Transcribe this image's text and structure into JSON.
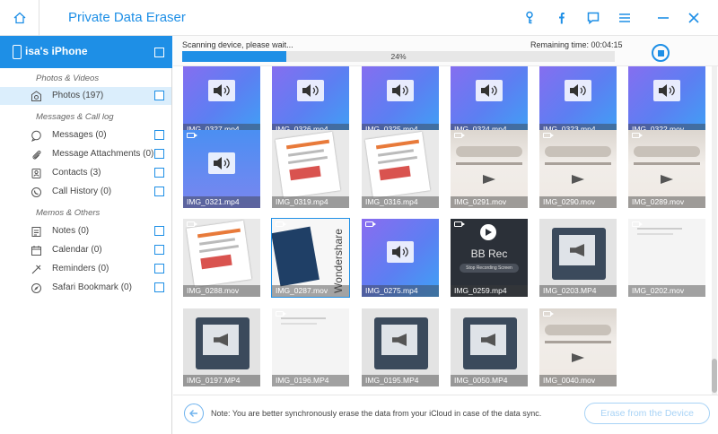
{
  "app": {
    "title": "Private Data Eraser"
  },
  "colors": {
    "accent": "#1e8fe6",
    "selected_row": "#dbeefc",
    "disabled_button": "#a8d3f6"
  },
  "titlebar_icons": [
    "key-icon",
    "facebook-icon",
    "feedback-icon",
    "menu-icon",
    "minimize-icon",
    "close-icon"
  ],
  "device": {
    "name": "isa's iPhone"
  },
  "sidebar": {
    "sections": [
      {
        "title": "Photos & Videos",
        "items": [
          {
            "label": "Photos (197)",
            "icon": "photos-icon",
            "selected": true
          }
        ]
      },
      {
        "title": "Messages & Call log",
        "items": [
          {
            "label": "Messages (0)",
            "icon": "messages-icon"
          },
          {
            "label": "Message Attachments (0)",
            "icon": "attachment-icon"
          },
          {
            "label": "Contacts (3)",
            "icon": "contacts-icon"
          },
          {
            "label": "Call History (0)",
            "icon": "call-history-icon"
          }
        ]
      },
      {
        "title": "Memos & Others",
        "items": [
          {
            "label": "Notes (0)",
            "icon": "notes-icon"
          },
          {
            "label": "Calendar (0)",
            "icon": "calendar-icon"
          },
          {
            "label": "Reminders (0)",
            "icon": "reminders-icon"
          },
          {
            "label": "Safari Bookmark (0)",
            "icon": "bookmark-icon"
          }
        ]
      }
    ]
  },
  "scan": {
    "status": "Scanning device, please wait...",
    "remaining": "Remaining time: 00:04:15",
    "percent_label": "24%",
    "progress": 0.24
  },
  "grid": {
    "rows": [
      [
        {
          "name": "IMG_0327.mp4",
          "kind": "purple"
        },
        {
          "name": "IMG_0326.mp4",
          "kind": "purple"
        },
        {
          "name": "IMG_0325.mp4",
          "kind": "purple"
        },
        {
          "name": "IMG_0324.mp4",
          "kind": "purple"
        },
        {
          "name": "IMG_0323.mp4",
          "kind": "purple"
        },
        {
          "name": "IMG_0322.mov",
          "kind": "purple",
          "video": true
        }
      ],
      [
        {
          "name": "IMG_0321.mp4",
          "kind": "blue",
          "video": true
        },
        {
          "name": "IMG_0319.mp4",
          "kind": "doc"
        },
        {
          "name": "IMG_0316.mp4",
          "kind": "doc"
        },
        {
          "name": "IMG_0291.mov",
          "kind": "panel",
          "video": true
        },
        {
          "name": "IMG_0290.mov",
          "kind": "panel",
          "video": true
        },
        {
          "name": "IMG_0289.mov",
          "kind": "panel",
          "video": true
        }
      ],
      [
        {
          "name": "IMG_0288.mov",
          "kind": "doc",
          "video": true
        },
        {
          "name": "IMG_0287.mov",
          "kind": "wondershare",
          "video": true,
          "selected": true,
          "overlay": "Wondershare"
        },
        {
          "name": "IMG_0275.mp4",
          "kind": "purple",
          "video": true
        },
        {
          "name": "IMG_0259.mp4",
          "kind": "bbrec",
          "video": true,
          "overlay": "BB Rec",
          "subtext": "Stop Recording Screen"
        },
        {
          "name": "IMG_0203.MP4",
          "kind": "phone"
        },
        {
          "name": "IMG_0202.mov",
          "kind": "white",
          "video": true
        }
      ],
      [
        {
          "name": "IMG_0197.MP4",
          "kind": "phone"
        },
        {
          "name": "IMG_0196.MP4",
          "kind": "white",
          "video": true
        },
        {
          "name": "IMG_0195.MP4",
          "kind": "phone"
        },
        {
          "name": "IMG_0050.MP4",
          "kind": "phone"
        },
        {
          "name": "IMG_0040.mov",
          "kind": "panel",
          "video": true
        }
      ]
    ]
  },
  "footer": {
    "note": "Note: You are better synchronously erase the data from your iCloud in case of the data sync.",
    "erase_button": "Erase from the Device"
  }
}
